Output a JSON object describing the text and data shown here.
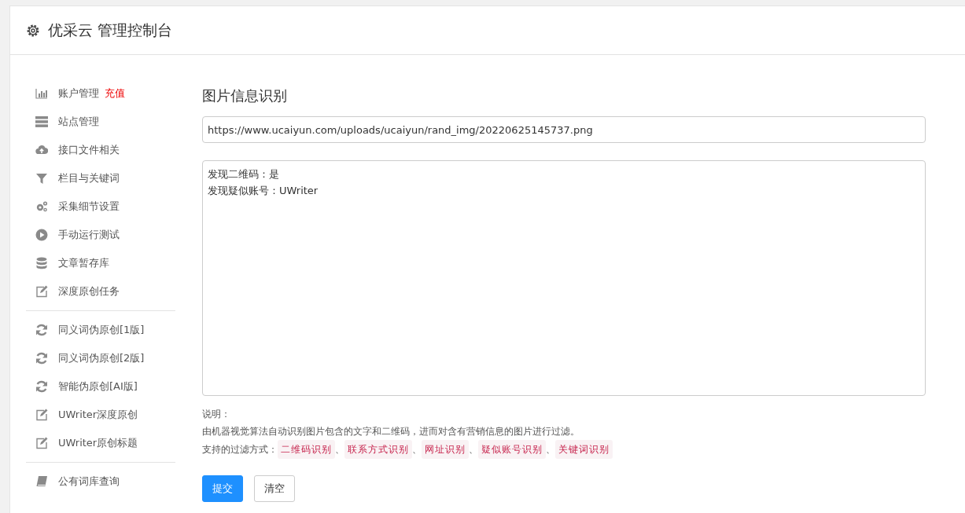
{
  "header": {
    "title": "优采云 管理控制台"
  },
  "sidebar": {
    "groups": [
      [
        {
          "kind": "chart",
          "label": "账户管理",
          "badge": "充值"
        },
        {
          "kind": "server",
          "label": "站点管理"
        },
        {
          "kind": "cloud",
          "label": "接口文件相关"
        },
        {
          "kind": "filter",
          "label": "栏目与关键词"
        },
        {
          "kind": "gears",
          "label": "采集细节设置"
        },
        {
          "kind": "play",
          "label": "手动运行测试"
        },
        {
          "kind": "database",
          "label": "文章暂存库"
        },
        {
          "kind": "edit",
          "label": "深度原创任务"
        }
      ],
      [
        {
          "kind": "refresh",
          "label": "同义词伪原创[1版]"
        },
        {
          "kind": "refresh",
          "label": "同义词伪原创[2版]"
        },
        {
          "kind": "refresh",
          "label": "智能伪原创[AI版]"
        },
        {
          "kind": "edit",
          "label": "UWriter深度原创"
        },
        {
          "kind": "edit",
          "label": "UWriter原创标题"
        }
      ],
      [
        {
          "kind": "book",
          "label": "公有词库查询"
        }
      ]
    ]
  },
  "main": {
    "title": "图片信息识别",
    "url_field": {
      "value": "https://www.ucaiyun.com/uploads/ucaiyun/rand_img/20220625145737.png"
    },
    "result_box": {
      "lines": [
        "发现二维码：是",
        "发现疑似账号：UWriter"
      ]
    },
    "notes": {
      "heading": "说明：",
      "description": "由机器视觉算法自动识别图片包含的文字和二维码，进而对含有营销信息的图片进行过滤。",
      "filters_label": "支持的过滤方式：",
      "filters": [
        {
          "label": "二维码识别",
          "separator": "、"
        },
        {
          "label": "联系方式识别",
          "separator": "、"
        },
        {
          "label": "网址识别",
          "separator": "、"
        },
        {
          "label": "疑似账号识别",
          "separator": "、"
        },
        {
          "label": "关键词识别"
        }
      ]
    },
    "buttons": [
      {
        "kind": "primary",
        "label": "提交"
      },
      {
        "kind": "default",
        "label": "清空"
      }
    ]
  }
}
